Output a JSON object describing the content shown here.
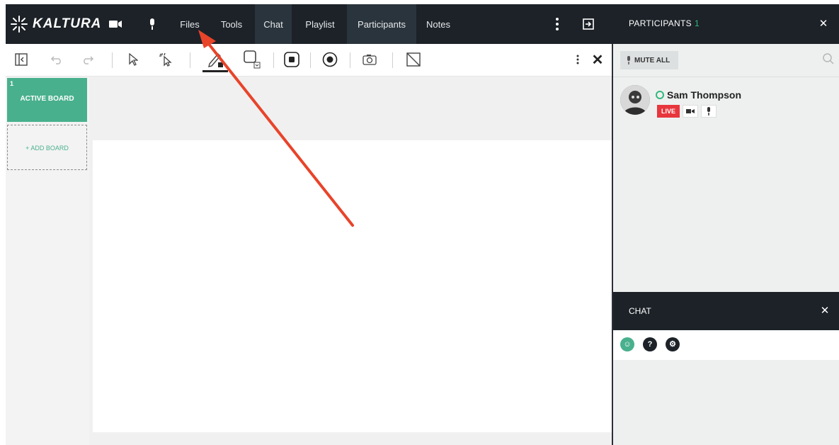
{
  "brand": {
    "name": "KALTURA"
  },
  "nav": {
    "items": [
      {
        "label": "Files"
      },
      {
        "label": "Tools"
      },
      {
        "label": "Chat"
      },
      {
        "label": "Playlist"
      },
      {
        "label": "Participants"
      },
      {
        "label": "Notes"
      }
    ]
  },
  "boards": {
    "active": {
      "number": "1",
      "label": "ACTIVE BOARD"
    },
    "add_label": "+ ADD BOARD"
  },
  "participants": {
    "title": "PARTICIPANTS",
    "count": "1",
    "mute_all_label": "MUTE ALL",
    "list": [
      {
        "name": "Sam Thompson",
        "status": "LIVE"
      }
    ]
  },
  "chat": {
    "title": "CHAT"
  },
  "colors": {
    "accent": "#49b08d",
    "live": "#e8363d",
    "online": "#32b87c",
    "header": "#1c2228",
    "annotation_arrow": "#e8442a"
  },
  "icons": [
    "camera-icon",
    "microphone-icon",
    "more-vertical-icon",
    "exit-icon",
    "close-icon",
    "collapse-icon",
    "undo-icon",
    "redo-icon",
    "select-pointer-icon",
    "laser-pointer-icon",
    "pen-icon",
    "shape-icon",
    "stop-icon",
    "record-icon",
    "camera-snapshot-icon",
    "clear-icon",
    "search-icon",
    "emoji-icon",
    "help-icon",
    "settings-icon"
  ]
}
